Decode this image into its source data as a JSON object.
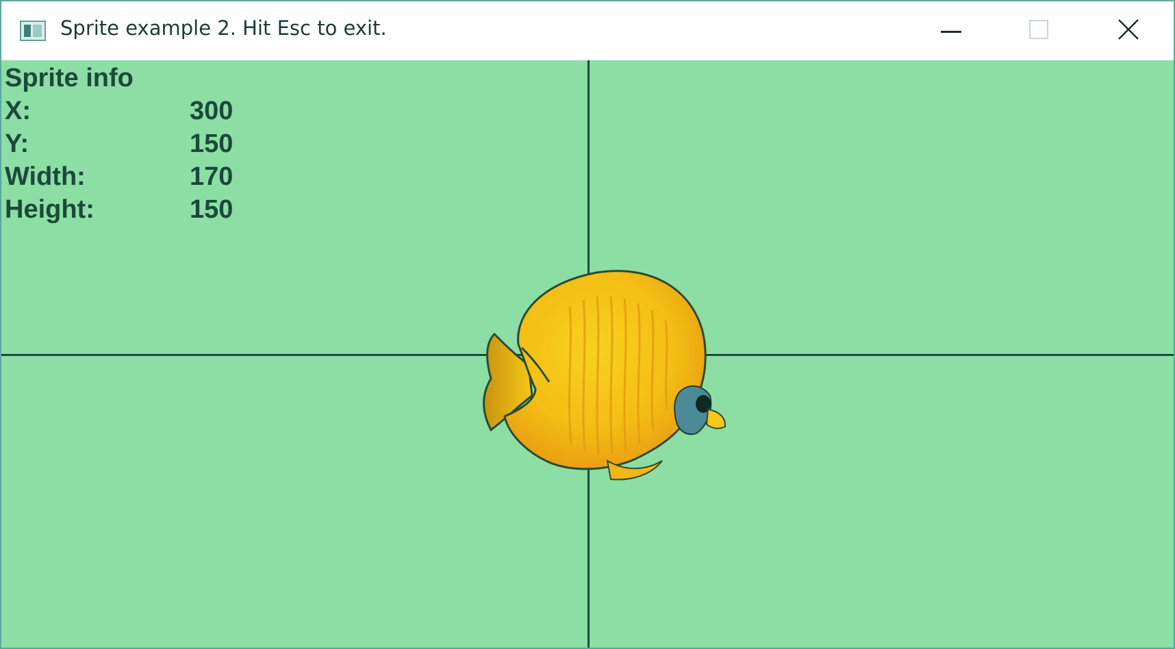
{
  "window": {
    "title": "Sprite example 2. Hit Esc to exit.",
    "app_icon": "window-app-icon",
    "controls": {
      "minimize_icon": "minimize-icon",
      "maximize_icon": "maximize-icon",
      "close_icon": "close-icon"
    }
  },
  "canvas": {
    "background_color": "#8cdea5",
    "crosshair_color": "#1e4a3c",
    "sprite_icon": "butterflyfish-sprite"
  },
  "sprite_info": {
    "title": "Sprite info",
    "rows": [
      {
        "label": "X:",
        "value": "300"
      },
      {
        "label": "Y:",
        "value": "150"
      },
      {
        "label": "Width:",
        "value": "170"
      },
      {
        "label": "Height:",
        "value": "150"
      }
    ]
  }
}
